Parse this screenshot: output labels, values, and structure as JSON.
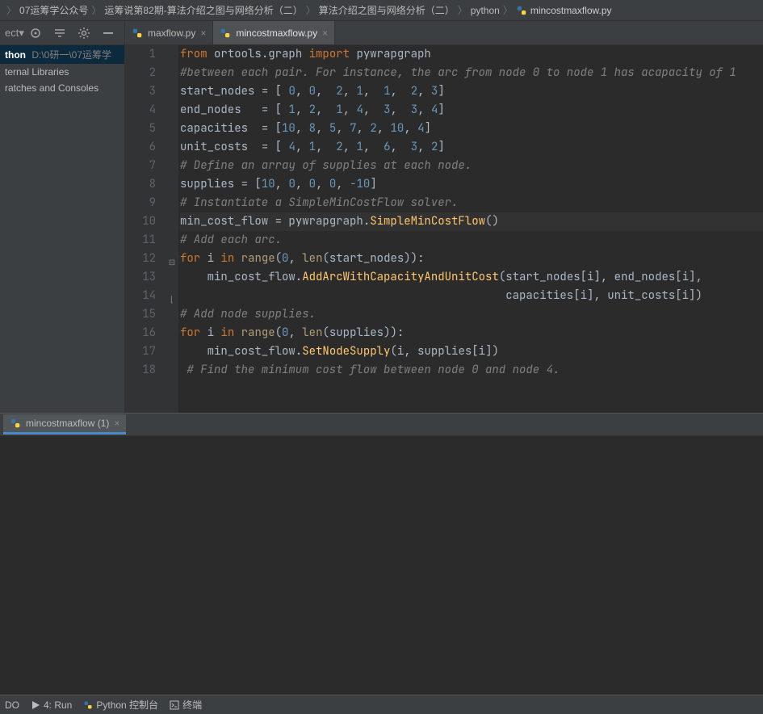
{
  "breadcrumb": {
    "items": [
      "07运筹学公众号",
      "运筹说第82期-算法介绍之图与网络分析（二）",
      "算法介绍之图与网络分析（二）",
      "python",
      "mincostmaxflow.py"
    ]
  },
  "toolbar": {
    "icons": [
      "select",
      "target",
      "collapse",
      "settings",
      "hide"
    ]
  },
  "tabs": [
    {
      "label": "maxflow.py",
      "active": false
    },
    {
      "label": "mincostmaxflow.py",
      "active": true
    }
  ],
  "sidebar": {
    "root_name": "thon",
    "root_path": "D:\\0研一\\07运筹学",
    "items": [
      "ternal Libraries",
      "ratches and Consoles"
    ]
  },
  "code": {
    "lines": [
      {
        "n": 1,
        "tokens": [
          [
            "kw",
            "from"
          ],
          [
            "sp",
            " "
          ],
          [
            "id",
            "ortools.graph"
          ],
          [
            "sp",
            " "
          ],
          [
            "kw",
            "import"
          ],
          [
            "sp",
            " "
          ],
          [
            "id",
            "pywrapgraph"
          ]
        ]
      },
      {
        "n": 2,
        "tokens": [
          [
            "com",
            "#between each pair. For instance, the arc from node 0 to node 1 has acapacity of 1"
          ]
        ]
      },
      {
        "n": 3,
        "tokens": [
          [
            "id",
            "start_nodes"
          ],
          [
            "sp",
            " "
          ],
          [
            "op",
            "="
          ],
          [
            "sp",
            " "
          ],
          [
            "op",
            "["
          ],
          [
            "sp",
            " "
          ],
          [
            "num",
            "0"
          ],
          [
            "op",
            ","
          ],
          [
            "sp",
            " "
          ],
          [
            "num",
            "0"
          ],
          [
            "op",
            ","
          ],
          [
            "sp",
            "  "
          ],
          [
            "num",
            "2"
          ],
          [
            "op",
            ","
          ],
          [
            "sp",
            " "
          ],
          [
            "num",
            "1"
          ],
          [
            "op",
            ","
          ],
          [
            "sp",
            "  "
          ],
          [
            "num",
            "1"
          ],
          [
            "op",
            ","
          ],
          [
            "sp",
            "  "
          ],
          [
            "num",
            "2"
          ],
          [
            "op",
            ","
          ],
          [
            "sp",
            " "
          ],
          [
            "num",
            "3"
          ],
          [
            "op",
            "]"
          ]
        ]
      },
      {
        "n": 4,
        "tokens": [
          [
            "id",
            "end_nodes"
          ],
          [
            "sp",
            "   "
          ],
          [
            "op",
            "="
          ],
          [
            "sp",
            " "
          ],
          [
            "op",
            "["
          ],
          [
            "sp",
            " "
          ],
          [
            "num",
            "1"
          ],
          [
            "op",
            ","
          ],
          [
            "sp",
            " "
          ],
          [
            "num",
            "2"
          ],
          [
            "op",
            ","
          ],
          [
            "sp",
            "  "
          ],
          [
            "num",
            "1"
          ],
          [
            "op",
            ","
          ],
          [
            "sp",
            " "
          ],
          [
            "num",
            "4"
          ],
          [
            "op",
            ","
          ],
          [
            "sp",
            "  "
          ],
          [
            "num",
            "3"
          ],
          [
            "op",
            ","
          ],
          [
            "sp",
            "  "
          ],
          [
            "num",
            "3"
          ],
          [
            "op",
            ","
          ],
          [
            "sp",
            " "
          ],
          [
            "num",
            "4"
          ],
          [
            "op",
            "]"
          ]
        ]
      },
      {
        "n": 5,
        "tokens": [
          [
            "id",
            "capacities"
          ],
          [
            "sp",
            "  "
          ],
          [
            "op",
            "="
          ],
          [
            "sp",
            " "
          ],
          [
            "op",
            "["
          ],
          [
            "num",
            "10"
          ],
          [
            "op",
            ","
          ],
          [
            "sp",
            " "
          ],
          [
            "num",
            "8"
          ],
          [
            "op",
            ","
          ],
          [
            "sp",
            " "
          ],
          [
            "num",
            "5"
          ],
          [
            "op",
            ","
          ],
          [
            "sp",
            " "
          ],
          [
            "num",
            "7"
          ],
          [
            "op",
            ","
          ],
          [
            "sp",
            " "
          ],
          [
            "num",
            "2"
          ],
          [
            "op",
            ","
          ],
          [
            "sp",
            " "
          ],
          [
            "num",
            "10"
          ],
          [
            "op",
            ","
          ],
          [
            "sp",
            " "
          ],
          [
            "num",
            "4"
          ],
          [
            "op",
            "]"
          ]
        ]
      },
      {
        "n": 6,
        "tokens": [
          [
            "id",
            "unit_costs"
          ],
          [
            "sp",
            "  "
          ],
          [
            "op",
            "="
          ],
          [
            "sp",
            " "
          ],
          [
            "op",
            "["
          ],
          [
            "sp",
            " "
          ],
          [
            "num",
            "4"
          ],
          [
            "op",
            ","
          ],
          [
            "sp",
            " "
          ],
          [
            "num",
            "1"
          ],
          [
            "op",
            ","
          ],
          [
            "sp",
            "  "
          ],
          [
            "num",
            "2"
          ],
          [
            "op",
            ","
          ],
          [
            "sp",
            " "
          ],
          [
            "num",
            "1"
          ],
          [
            "op",
            ","
          ],
          [
            "sp",
            "  "
          ],
          [
            "num",
            "6"
          ],
          [
            "op",
            ","
          ],
          [
            "sp",
            "  "
          ],
          [
            "num",
            "3"
          ],
          [
            "op",
            ","
          ],
          [
            "sp",
            " "
          ],
          [
            "num",
            "2"
          ],
          [
            "op",
            "]"
          ]
        ]
      },
      {
        "n": 7,
        "tokens": [
          [
            "com",
            "# Define an array of supplies at each node."
          ]
        ]
      },
      {
        "n": 8,
        "tokens": [
          [
            "id",
            "supplies"
          ],
          [
            "sp",
            " "
          ],
          [
            "op",
            "="
          ],
          [
            "sp",
            " "
          ],
          [
            "op",
            "["
          ],
          [
            "num",
            "10"
          ],
          [
            "op",
            ","
          ],
          [
            "sp",
            " "
          ],
          [
            "num",
            "0"
          ],
          [
            "op",
            ","
          ],
          [
            "sp",
            " "
          ],
          [
            "num",
            "0"
          ],
          [
            "op",
            ","
          ],
          [
            "sp",
            " "
          ],
          [
            "num",
            "0"
          ],
          [
            "op",
            ","
          ],
          [
            "sp",
            " "
          ],
          [
            "num",
            "-10"
          ],
          [
            "op",
            "]"
          ]
        ]
      },
      {
        "n": 9,
        "tokens": [
          [
            "com",
            "# Instantiate a SimpleMinCostFlow solver."
          ]
        ]
      },
      {
        "n": 10,
        "current": true,
        "tokens": [
          [
            "id",
            "min_cost_flow"
          ],
          [
            "sp",
            " "
          ],
          [
            "op",
            "="
          ],
          [
            "sp",
            " "
          ],
          [
            "id",
            "pywrapgraph."
          ],
          [
            "fn",
            "SimpleMinCostFlow"
          ],
          [
            "op",
            "()"
          ]
        ]
      },
      {
        "n": 11,
        "tokens": [
          [
            "com",
            "# Add each arc."
          ]
        ]
      },
      {
        "n": 12,
        "fold": "start",
        "tokens": [
          [
            "kw",
            "for"
          ],
          [
            "sp",
            " "
          ],
          [
            "id",
            "i"
          ],
          [
            "sp",
            " "
          ],
          [
            "kw",
            "in"
          ],
          [
            "sp",
            " "
          ],
          [
            "call",
            "range"
          ],
          [
            "op",
            "("
          ],
          [
            "num",
            "0"
          ],
          [
            "op",
            ","
          ],
          [
            "sp",
            " "
          ],
          [
            "call",
            "len"
          ],
          [
            "op",
            "("
          ],
          [
            "id",
            "start_nodes"
          ],
          [
            "op",
            "))"
          ],
          [
            "op",
            ":"
          ]
        ]
      },
      {
        "n": 13,
        "tokens": [
          [
            "sp",
            "    "
          ],
          [
            "id",
            "min_cost_flow."
          ],
          [
            "fn",
            "AddArcWithCapacityAndUnitCost"
          ],
          [
            "op",
            "("
          ],
          [
            "id",
            "start_nodes"
          ],
          [
            "op",
            "["
          ],
          [
            "id",
            "i"
          ],
          [
            "op",
            "]"
          ],
          [
            "op",
            ","
          ],
          [
            "sp",
            " "
          ],
          [
            "id",
            "end_nodes"
          ],
          [
            "op",
            "["
          ],
          [
            "id",
            "i"
          ],
          [
            "op",
            "]"
          ],
          [
            "op",
            ","
          ]
        ]
      },
      {
        "n": 14,
        "fold": "end",
        "tokens": [
          [
            "sp",
            "                                                "
          ],
          [
            "id",
            "capacities"
          ],
          [
            "op",
            "["
          ],
          [
            "id",
            "i"
          ],
          [
            "op",
            "]"
          ],
          [
            "op",
            ","
          ],
          [
            "sp",
            " "
          ],
          [
            "id",
            "unit_costs"
          ],
          [
            "op",
            "["
          ],
          [
            "id",
            "i"
          ],
          [
            "op",
            "]"
          ],
          [
            "op",
            ")"
          ]
        ]
      },
      {
        "n": 15,
        "tokens": [
          [
            "com",
            "# Add node supplies."
          ]
        ]
      },
      {
        "n": 16,
        "tokens": [
          [
            "kw",
            "for"
          ],
          [
            "sp",
            " "
          ],
          [
            "id",
            "i"
          ],
          [
            "sp",
            " "
          ],
          [
            "kw",
            "in"
          ],
          [
            "sp",
            " "
          ],
          [
            "call",
            "range"
          ],
          [
            "op",
            "("
          ],
          [
            "num",
            "0"
          ],
          [
            "op",
            ","
          ],
          [
            "sp",
            " "
          ],
          [
            "call",
            "len"
          ],
          [
            "op",
            "("
          ],
          [
            "id",
            "supplies"
          ],
          [
            "op",
            "))"
          ],
          [
            "op",
            ":"
          ]
        ]
      },
      {
        "n": 17,
        "tokens": [
          [
            "sp",
            "    "
          ],
          [
            "id",
            "min_cost_flow."
          ],
          [
            "fn",
            "SetNodeSupply"
          ],
          [
            "op",
            "("
          ],
          [
            "id",
            "i"
          ],
          [
            "op",
            ","
          ],
          [
            "sp",
            " "
          ],
          [
            "id",
            "supplies"
          ],
          [
            "op",
            "["
          ],
          [
            "id",
            "i"
          ],
          [
            "op",
            "]"
          ],
          [
            "op",
            ")"
          ]
        ]
      },
      {
        "n": 18,
        "tokens": [
          [
            "sp",
            " "
          ],
          [
            "com",
            "# Find the minimum cost flow between node 0 and node 4."
          ]
        ]
      }
    ]
  },
  "run": {
    "tab_label": "mincostmaxflow (1)"
  },
  "status": {
    "items": [
      "DO",
      "4: Run",
      "Python 控制台",
      "终端"
    ]
  }
}
